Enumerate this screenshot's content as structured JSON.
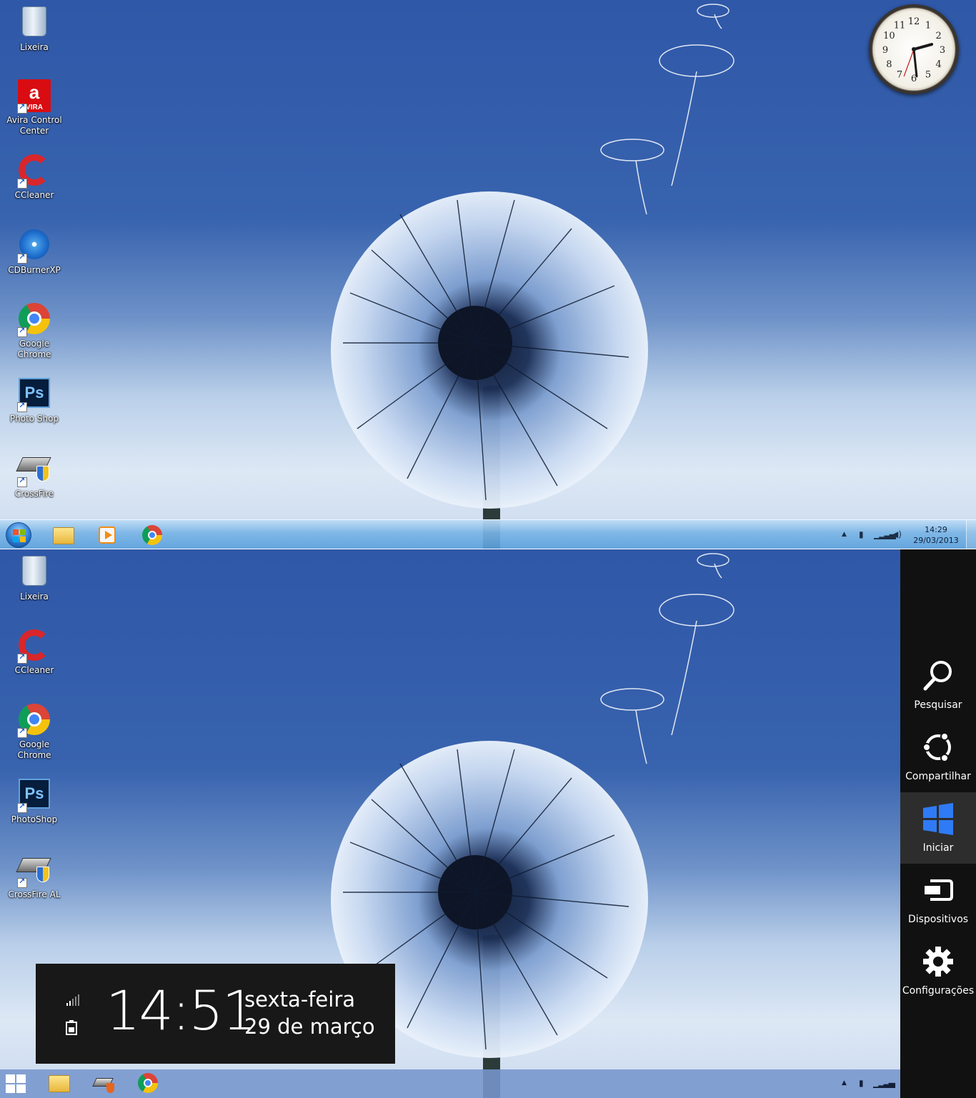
{
  "top_desktop": {
    "icons": [
      {
        "label": "Lixeira",
        "icon": "recycle-bin-icon"
      },
      {
        "label": "Avira Control Center",
        "icon": "avira-icon"
      },
      {
        "label": "CCleaner",
        "icon": "ccleaner-icon"
      },
      {
        "label": "CDBurnerXP",
        "icon": "cdburnerxp-icon"
      },
      {
        "label": "Google Chrome",
        "icon": "chrome-icon"
      },
      {
        "label": "Photo Shop",
        "icon": "photoshop-icon"
      },
      {
        "label": "CrossFire",
        "icon": "crossfire-icon"
      }
    ],
    "clock_gadget": {
      "numerals": [
        "12",
        "1",
        "2",
        "3",
        "4",
        "5",
        "6",
        "7",
        "8",
        "9",
        "10",
        "11"
      ],
      "hour": 14,
      "minute": 29
    },
    "taskbar": {
      "pinned": [
        {
          "icon": "windows-explorer-icon"
        },
        {
          "icon": "media-player-icon"
        },
        {
          "icon": "chrome-icon"
        }
      ],
      "tray": {
        "time": "14:29",
        "date": "29/03/2013"
      }
    }
  },
  "bottom_desktop": {
    "icons": [
      {
        "label": "Lixeira",
        "icon": "recycle-bin-icon"
      },
      {
        "label": "CCleaner",
        "icon": "ccleaner-icon"
      },
      {
        "label": "Google Chrome",
        "icon": "chrome-icon"
      },
      {
        "label": "PhotoShop",
        "icon": "photoshop-icon"
      },
      {
        "label": "CrossFire AL",
        "icon": "crossfire-icon"
      }
    ],
    "charms": [
      {
        "label": "Pesquisar",
        "icon": "search-icon"
      },
      {
        "label": "Compartilhar",
        "icon": "share-icon"
      },
      {
        "label": "Iniciar",
        "icon": "windows-logo-icon",
        "active": true
      },
      {
        "label": "Dispositivos",
        "icon": "devices-icon"
      },
      {
        "label": "Configurações",
        "icon": "settings-icon"
      }
    ],
    "datetime_overlay": {
      "time": "14:51",
      "day": "sexta-feira",
      "date": "29 de março"
    },
    "taskbar": {
      "pinned": [
        {
          "icon": "file-explorer-icon"
        },
        {
          "icon": "crossfire-icon"
        },
        {
          "icon": "chrome-icon"
        }
      ]
    }
  },
  "colors": {
    "charms_bg": "#111111",
    "charms_active": "#2d2d2d",
    "win_logo_blue": "#2f7bf5"
  }
}
